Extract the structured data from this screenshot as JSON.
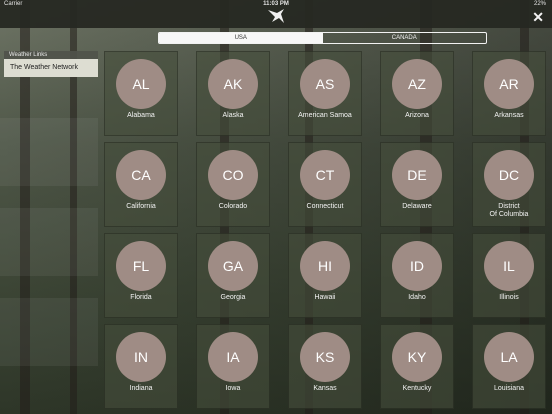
{
  "status_bar": {
    "carrier": "Carrier",
    "time": "11:03 PM",
    "battery": "22%"
  },
  "tabs": [
    {
      "label": "USA",
      "active": true
    },
    {
      "label": "CANADA",
      "active": false
    }
  ],
  "sidebar": {
    "header": "Weather Links",
    "items": [
      {
        "label": "The Weather Network"
      }
    ]
  },
  "states": [
    {
      "abbr": "AL",
      "name": "Alabama"
    },
    {
      "abbr": "AK",
      "name": "Alaska"
    },
    {
      "abbr": "AS",
      "name": "American Samoa"
    },
    {
      "abbr": "AZ",
      "name": "Arizona"
    },
    {
      "abbr": "AR",
      "name": "Arkansas"
    },
    {
      "abbr": "CA",
      "name": "California"
    },
    {
      "abbr": "CO",
      "name": "Colorado"
    },
    {
      "abbr": "CT",
      "name": "Connecticut"
    },
    {
      "abbr": "DE",
      "name": "Delaware"
    },
    {
      "abbr": "DC",
      "name": "District\nOf Columbia"
    },
    {
      "abbr": "FL",
      "name": "Florida"
    },
    {
      "abbr": "GA",
      "name": "Georgia"
    },
    {
      "abbr": "HI",
      "name": "Hawaii"
    },
    {
      "abbr": "ID",
      "name": "Idaho"
    },
    {
      "abbr": "IL",
      "name": "Illinois"
    },
    {
      "abbr": "IN",
      "name": "Indiana"
    },
    {
      "abbr": "IA",
      "name": "Iowa"
    },
    {
      "abbr": "KS",
      "name": "Kansas"
    },
    {
      "abbr": "KY",
      "name": "Kentucky"
    },
    {
      "abbr": "LA",
      "name": "Louisiana"
    }
  ],
  "colors": {
    "circle": "#9f8c85",
    "accent": "#f7f7f7",
    "sidebar_item_bg": "#ddddd2"
  }
}
